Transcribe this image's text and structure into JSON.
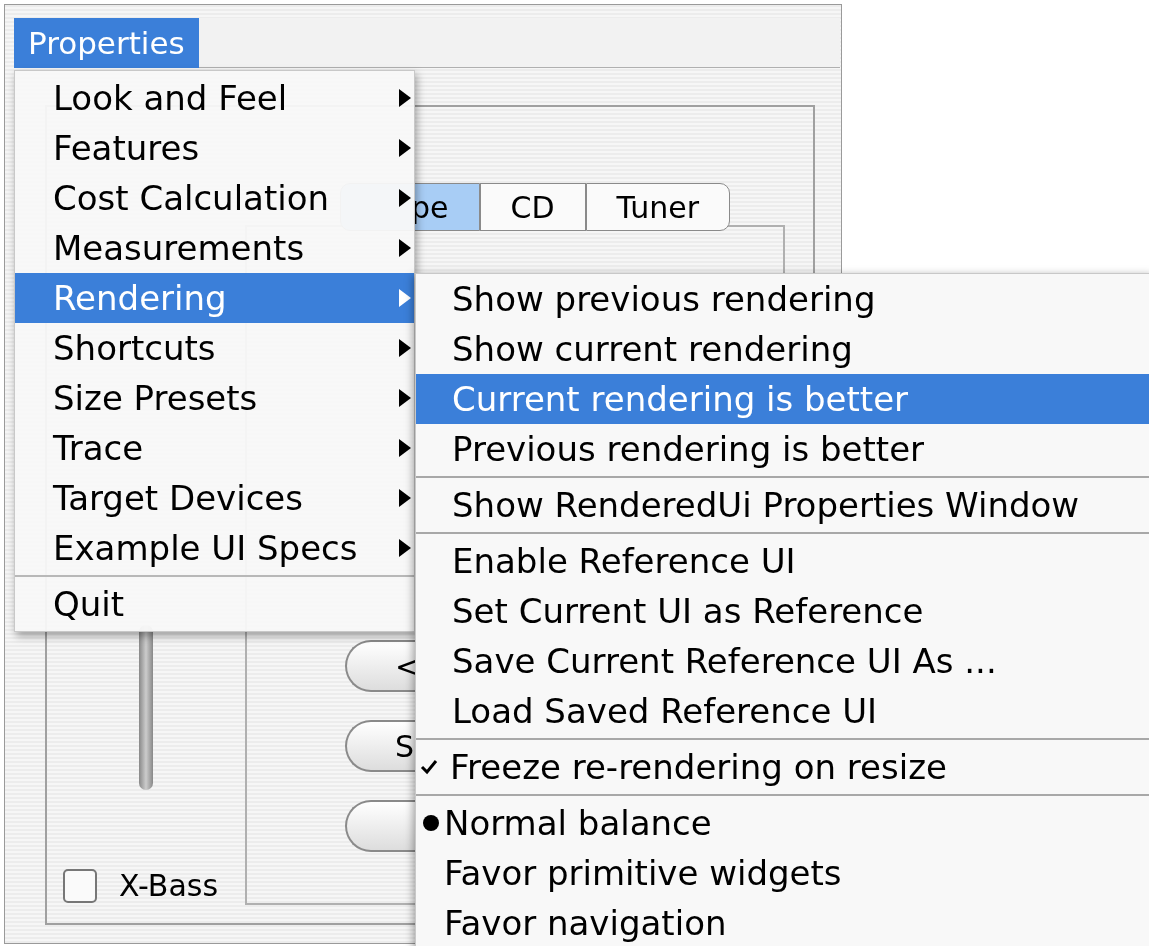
{
  "menu_bar": {
    "title": "Properties",
    "selected": true
  },
  "background_window": {
    "tabs": [
      {
        "label": "pe",
        "selected": true
      },
      {
        "label": "CD",
        "selected": false
      },
      {
        "label": "Tuner",
        "selected": false
      }
    ],
    "buttons": [
      "<",
      "S"
    ],
    "checkbox": {
      "label": "X-Bass",
      "checked": false
    }
  },
  "menu": {
    "items": [
      {
        "kind": "submenu",
        "label": "Look and Feel",
        "selected": false
      },
      {
        "kind": "submenu",
        "label": "Features",
        "selected": false
      },
      {
        "kind": "submenu",
        "label": "Cost Calculation",
        "selected": false
      },
      {
        "kind": "submenu",
        "label": "Measurements",
        "selected": false
      },
      {
        "kind": "submenu",
        "label": "Rendering",
        "selected": true
      },
      {
        "kind": "submenu",
        "label": "Shortcuts",
        "selected": false
      },
      {
        "kind": "submenu",
        "label": "Size Presets",
        "selected": false
      },
      {
        "kind": "submenu",
        "label": "Trace",
        "selected": false
      },
      {
        "kind": "submenu",
        "label": "Target Devices",
        "selected": false
      },
      {
        "kind": "submenu",
        "label": "Example UI Specs",
        "selected": false
      },
      {
        "kind": "separator"
      },
      {
        "kind": "action",
        "label": "Quit",
        "selected": false
      }
    ]
  },
  "submenu": {
    "items": [
      {
        "kind": "action",
        "label": "Show previous rendering",
        "selected": false
      },
      {
        "kind": "action",
        "label": "Show current rendering",
        "selected": false
      },
      {
        "kind": "action",
        "label": "Current rendering is better",
        "selected": true
      },
      {
        "kind": "action",
        "label": "Previous rendering is better",
        "selected": false
      },
      {
        "kind": "separator"
      },
      {
        "kind": "action",
        "label": "Show RenderedUi Properties Window",
        "selected": false
      },
      {
        "kind": "separator"
      },
      {
        "kind": "action",
        "label": "Enable Reference UI",
        "selected": false
      },
      {
        "kind": "action",
        "label": "Set Current UI as Reference",
        "selected": false
      },
      {
        "kind": "action",
        "label": "Save Current Reference UI As ...",
        "selected": false
      },
      {
        "kind": "action",
        "label": "Load Saved Reference UI",
        "selected": false
      },
      {
        "kind": "separator"
      },
      {
        "kind": "check",
        "label": "Freeze re-rendering on resize",
        "checked": true,
        "selected": false
      },
      {
        "kind": "separator"
      },
      {
        "kind": "radio",
        "label": "Normal balance",
        "checked": true,
        "selected": false
      },
      {
        "kind": "radio",
        "label": "Favor primitive widgets",
        "checked": false,
        "selected": false
      },
      {
        "kind": "radio",
        "label": "Favor navigation",
        "checked": false,
        "selected": false
      }
    ]
  }
}
